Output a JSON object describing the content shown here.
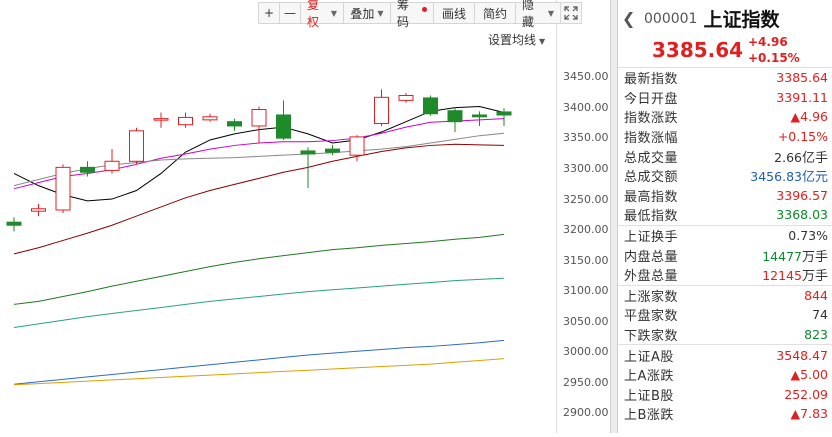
{
  "toolbar": {
    "items": [
      {
        "label": "+",
        "name": "zoom-in-button"
      },
      {
        "label": "—",
        "name": "zoom-out-button"
      },
      {
        "label": "复权",
        "name": "restore-rights-button"
      },
      {
        "label": "叠加",
        "name": "overlay-button"
      },
      {
        "label": "筹码",
        "name": "chips-button"
      },
      {
        "label": "画线",
        "name": "draw-line-button"
      },
      {
        "label": "简约",
        "name": "simple-mode-button"
      },
      {
        "label": "隐藏",
        "name": "hide-button"
      }
    ],
    "fullscreen_icon": "expand-icon"
  },
  "ma_setting": {
    "label": "设置均线"
  },
  "y_axis": {
    "ticks": [
      "3450.00",
      "3400.00",
      "3350.00",
      "3300.00",
      "3250.00",
      "3200.00",
      "3150.00",
      "3100.00",
      "3050.00",
      "3000.00",
      "2950.00",
      "2900.00"
    ]
  },
  "chart_data": {
    "type": "candlestick",
    "ylim": [
      2900,
      3450
    ],
    "candles": [
      {
        "open": 3210,
        "close": 3205,
        "high": 3218,
        "low": 3195
      },
      {
        "open": 3228,
        "close": 3232,
        "high": 3240,
        "low": 3220
      },
      {
        "open": 3230,
        "close": 3300,
        "high": 3305,
        "low": 3225
      },
      {
        "open": 3300,
        "close": 3292,
        "high": 3310,
        "low": 3285
      },
      {
        "open": 3295,
        "close": 3310,
        "high": 3330,
        "low": 3290
      },
      {
        "open": 3310,
        "close": 3360,
        "high": 3365,
        "low": 3305
      },
      {
        "open": 3378,
        "close": 3380,
        "high": 3390,
        "low": 3365
      },
      {
        "open": 3370,
        "close": 3382,
        "high": 3390,
        "low": 3365
      },
      {
        "open": 3378,
        "close": 3383,
        "high": 3388,
        "low": 3375
      },
      {
        "open": 3375,
        "close": 3368,
        "high": 3380,
        "low": 3360
      },
      {
        "open": 3368,
        "close": 3395,
        "high": 3400,
        "low": 3340
      },
      {
        "open": 3386,
        "close": 3348,
        "high": 3410,
        "low": 3345
      },
      {
        "open": 3327,
        "close": 3322,
        "high": 3333,
        "low": 3266
      },
      {
        "open": 3330,
        "close": 3325,
        "high": 3337,
        "low": 3320
      },
      {
        "open": 3320,
        "close": 3350,
        "high": 3353,
        "low": 3310
      },
      {
        "open": 3372,
        "close": 3415,
        "high": 3428,
        "low": 3368
      },
      {
        "open": 3410,
        "close": 3418,
        "high": 3422,
        "low": 3406
      },
      {
        "open": 3414,
        "close": 3388,
        "high": 3418,
        "low": 3385
      },
      {
        "open": 3393,
        "close": 3375,
        "high": 3399,
        "low": 3358
      },
      {
        "open": 3386,
        "close": 3383,
        "high": 3392,
        "low": 3368
      },
      {
        "open": 3391,
        "close": 3386,
        "high": 3397,
        "low": 3368
      }
    ],
    "ma_lines": [
      {
        "color": "#000000",
        "values": [
          3290,
          3270,
          3255,
          3245,
          3248,
          3262,
          3290,
          3325,
          3345,
          3355,
          3362,
          3366,
          3355,
          3340,
          3345,
          3358,
          3375,
          3392,
          3398,
          3400,
          3390
        ]
      },
      {
        "color": "#cc00cc",
        "values": [
          3265,
          3275,
          3285,
          3290,
          3296,
          3305,
          3315,
          3322,
          3330,
          3336,
          3340,
          3342,
          3342,
          3344,
          3348,
          3356,
          3366,
          3374,
          3376,
          3378,
          3380
        ]
      },
      {
        "color": "#888888",
        "values": [
          3270,
          3280,
          3290,
          3298,
          3304,
          3308,
          3312,
          3314,
          3315,
          3316,
          3318,
          3320,
          3322,
          3324,
          3327,
          3330,
          3334,
          3340,
          3346,
          3352,
          3356
        ]
      },
      {
        "color": "#8b0000",
        "values": [
          3158,
          3168,
          3180,
          3192,
          3205,
          3220,
          3235,
          3250,
          3262,
          3272,
          3282,
          3292,
          3300,
          3310,
          3318,
          3326,
          3332,
          3336,
          3338,
          3337,
          3336
        ]
      },
      {
        "color": "#1f7a1f",
        "values": [
          3075,
          3080,
          3088,
          3096,
          3105,
          3113,
          3121,
          3129,
          3137,
          3144,
          3150,
          3155,
          3160,
          3165,
          3168,
          3172,
          3175,
          3178,
          3182,
          3185,
          3190
        ]
      },
      {
        "color": "#2b6cc4",
        "values": [
          2944,
          2948,
          2952,
          2956,
          2960,
          2964,
          2968,
          2972,
          2976,
          2980,
          2984,
          2988,
          2992,
          2995,
          2998,
          3001,
          3004,
          3006,
          3009,
          3012,
          3016
        ]
      },
      {
        "color": "#e0a000",
        "values": [
          2943,
          2945,
          2947,
          2949,
          2951,
          2953,
          2955,
          2957,
          2959,
          2961,
          2963,
          2965,
          2967,
          2969,
          2971,
          2973,
          2975,
          2977,
          2980,
          2983,
          2986
        ]
      },
      {
        "color": "#2aa08a",
        "values": [
          3037,
          3043,
          3049,
          3055,
          3060,
          3065,
          3070,
          3075,
          3080,
          3084,
          3088,
          3092,
          3096,
          3099,
          3102,
          3105,
          3108,
          3111,
          3114,
          3116,
          3118
        ]
      }
    ]
  },
  "panel": {
    "code": "000001",
    "name": "上证指数",
    "price": "3385.64",
    "change": "+4.96",
    "change_pct": "+0.15%",
    "group1": [
      {
        "label": "最新指数",
        "value": "3385.64",
        "unit": "",
        "color": "red"
      },
      {
        "label": "今日开盘",
        "value": "3391.11",
        "unit": "",
        "color": "red"
      },
      {
        "label": "指数涨跌",
        "value": "▲4.96",
        "unit": "",
        "color": "red"
      },
      {
        "label": "指数涨幅",
        "value": "+0.15%",
        "unit": "",
        "color": "red"
      },
      {
        "label": "总成交量",
        "value": "2.66",
        "unit": "亿手",
        "color": "dark"
      },
      {
        "label": "总成交额",
        "value": "3456.83",
        "unit": "亿元",
        "color": "blue"
      },
      {
        "label": "最高指数",
        "value": "3396.57",
        "unit": "",
        "color": "red"
      },
      {
        "label": "最低指数",
        "value": "3368.03",
        "unit": "",
        "color": "green"
      }
    ],
    "group2": [
      {
        "label": "上证换手",
        "value": "0.73%",
        "unit": "",
        "color": "dark"
      },
      {
        "label": "内盘总量",
        "value": "14477",
        "unit": "万手",
        "color": "green"
      },
      {
        "label": "外盘总量",
        "value": "12145",
        "unit": "万手",
        "color": "red"
      }
    ],
    "group3": [
      {
        "label": "上涨家数",
        "value": "844",
        "unit": "",
        "color": "red"
      },
      {
        "label": "平盘家数",
        "value": "74",
        "unit": "",
        "color": "dark"
      },
      {
        "label": "下跌家数",
        "value": "823",
        "unit": "",
        "color": "green"
      }
    ],
    "group4": [
      {
        "label": "上证A股",
        "value": "3548.47",
        "unit": "",
        "color": "red"
      },
      {
        "label": "上A涨跌",
        "value": "▲5.00",
        "unit": "",
        "color": "red"
      },
      {
        "label": "上证B股",
        "value": "252.09",
        "unit": "",
        "color": "red"
      },
      {
        "label": "上B涨跌",
        "value": "▲7.83",
        "unit": "",
        "color": "red"
      }
    ]
  }
}
